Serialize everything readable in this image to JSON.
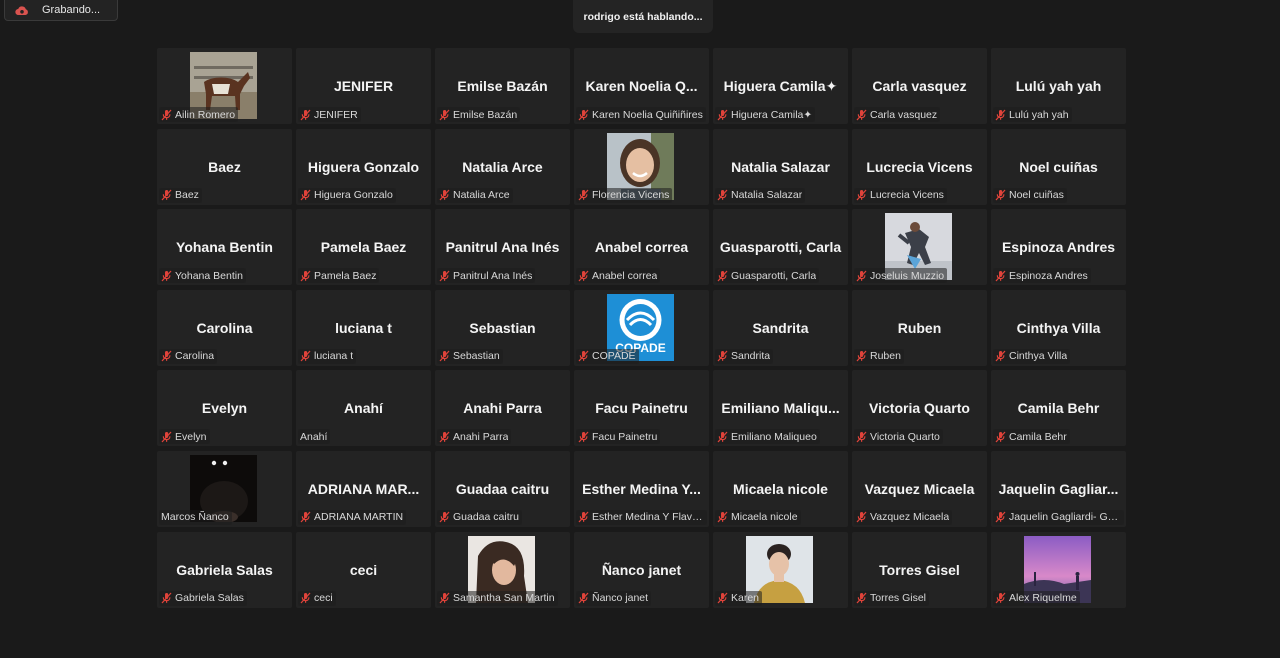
{
  "recording": {
    "label": "Grabando...",
    "icon": "recording-cloud-icon",
    "icon_color": "#d9534f"
  },
  "speaking": {
    "text": "rodrigo está hablando..."
  },
  "mute_color": "#e0433a",
  "participants": [
    {
      "label": "Ailin Romero",
      "muted": true,
      "avatar": "horse"
    },
    {
      "name": "JENIFER",
      "label": "JENIFER",
      "muted": true
    },
    {
      "name": "Emilse Bazán",
      "label": "Emilse Bazán",
      "muted": true
    },
    {
      "name": "Karen Noelia Q...",
      "label": "Karen Noelia Quiñiñires",
      "muted": true
    },
    {
      "name": "Higuera Camila✦",
      "label": "Higuera Camila✦",
      "muted": true
    },
    {
      "name": "Carla vasquez",
      "label": "Carla vasquez",
      "muted": true
    },
    {
      "name": "Lulú yah yah",
      "label": "Lulú yah yah",
      "muted": true
    },
    {
      "name": "Baez",
      "label": "Baez",
      "muted": true
    },
    {
      "name": "Higuera Gonzalo",
      "label": "Higuera Gonzalo",
      "muted": true
    },
    {
      "name": "Natalia Arce",
      "label": "Natalia Arce",
      "muted": true
    },
    {
      "label": "Florencia Vicens",
      "muted": true,
      "avatar": "woman-smiling"
    },
    {
      "name": "Natalia Salazar",
      "label": "Natalia Salazar",
      "muted": true
    },
    {
      "name": "Lucrecia Vicens",
      "label": "Lucrecia Vicens",
      "muted": true
    },
    {
      "name": "Noel cuiñas",
      "label": "Noel cuiñas",
      "muted": true
    },
    {
      "name": "Yohana Bentin",
      "label": "Yohana Bentin",
      "muted": true
    },
    {
      "name": "Pamela Baez",
      "label": "Pamela Baez",
      "muted": true
    },
    {
      "name": "Panitrul Ana Inés",
      "label": "Panitrul Ana Inés",
      "muted": true
    },
    {
      "name": "Anabel correa",
      "label": "Anabel correa",
      "muted": true
    },
    {
      "name": "Guasparotti, Carla",
      "label": "Guasparotti, Carla",
      "muted": true
    },
    {
      "label": "Joseluis Muzzio",
      "muted": true,
      "avatar": "dancer"
    },
    {
      "name": "Espinoza Andres",
      "label": "Espinoza Andres",
      "muted": true
    },
    {
      "name": "Carolina",
      "label": "Carolina",
      "muted": true
    },
    {
      "name": "luciana t",
      "label": "luciana t",
      "muted": true
    },
    {
      "name": "Sebastian",
      "label": "Sebastian",
      "muted": true
    },
    {
      "label": "COPADE",
      "muted": true,
      "avatar": "copade-logo",
      "logo_text": "COPADE"
    },
    {
      "name": "Sandrita",
      "label": "Sandrita",
      "muted": true
    },
    {
      "name": "Ruben",
      "label": "Ruben",
      "muted": true
    },
    {
      "name": "Cinthya Villa",
      "label": "Cinthya Villa",
      "muted": true
    },
    {
      "name": "Evelyn",
      "label": "Evelyn",
      "muted": true
    },
    {
      "name": "Anahí",
      "label": "Anahí",
      "muted": false
    },
    {
      "name": "Anahi Parra",
      "label": "Anahi Parra",
      "muted": true
    },
    {
      "name": "Facu Painetru",
      "label": "Facu Painetru",
      "muted": true
    },
    {
      "name": "Emiliano Maliqu...",
      "label": "Emiliano Maliqueo",
      "muted": true
    },
    {
      "name": "Victoria Quarto",
      "label": "Victoria Quarto",
      "muted": true
    },
    {
      "name": "Camila Behr",
      "label": "Camila Behr",
      "muted": true
    },
    {
      "label": "Marcos Ñanco",
      "muted": false,
      "avatar": "dark-eyes"
    },
    {
      "name": "ADRIANA MAR...",
      "label": "ADRIANA MARTIN",
      "muted": true
    },
    {
      "name": "Guadaa caitru",
      "label": "Guadaa caitru",
      "muted": true
    },
    {
      "name": "Esther Medina Y...",
      "label": "Esther Medina Y Flavio...",
      "muted": true
    },
    {
      "name": "Micaela nicole",
      "label": "Micaela nicole",
      "muted": true
    },
    {
      "name": "Vazquez Micaela",
      "label": "Vazquez Micaela",
      "muted": true
    },
    {
      "name": "Jaquelin Gagliar...",
      "label": "Jaquelin Gagliardi- GEO",
      "muted": true
    },
    {
      "name": "Gabriela Salas",
      "label": "Gabriela Salas",
      "muted": true
    },
    {
      "name": "ceci",
      "label": "ceci",
      "muted": true
    },
    {
      "label": "Samantha San Martin",
      "muted": true,
      "avatar": "woman-hair"
    },
    {
      "name": "Ñanco janet",
      "label": "Ñanco janet",
      "muted": true
    },
    {
      "label": "Karen",
      "muted": true,
      "avatar": "woman-portrait"
    },
    {
      "name": "Torres Gisel",
      "label": "Torres Gisel",
      "muted": true
    },
    {
      "label": "Alex Riquelme",
      "muted": true,
      "avatar": "sunset-landscape"
    }
  ]
}
